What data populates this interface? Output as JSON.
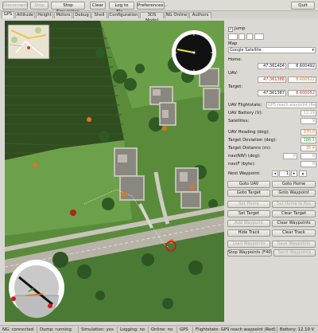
{
  "toolbar": {
    "disconnect": "Disconnect",
    "stop": "Stop",
    "stop_simulation": "Stop Simulation",
    "clear": "Clear",
    "log_to_file": "Log to file...",
    "preferences": "Preferences...",
    "quit": "Quit"
  },
  "tabs": [
    "GPS",
    "Attitude",
    "Height",
    "Motors",
    "Debug",
    "Shell",
    "Configuration",
    "3DS Model",
    "NG Online",
    "Authors"
  ],
  "active_tab": "GPS",
  "map_type_label": "Map",
  "panel": {
    "jump_label": "Jump",
    "jump_checked": true,
    "map_select": "Google Satellite",
    "home_label": "Home:",
    "home_lat": "47.361404",
    "home_lon": "8.600492",
    "uav_label": "UAV:",
    "uav_lat": "47.361388",
    "uav_lon": "8.600522",
    "target_label": "Target:",
    "target_lat": "47.361387",
    "target_lon": "8.600052",
    "flightstate_label": "UAV Flightstate:",
    "flightstate_value": "GPS reach waypoint (Red)",
    "battery_label": "UAV Battery (V):",
    "battery_value": "12.19",
    "satellites_label": "Satellites:",
    "satellites_value": "9",
    "heading_label": "UAV Heading (deg):",
    "heading_value": "270.0",
    "deviation_label": "Target Deviation (deg):",
    "deviation_value": "186.1",
    "distance_label": "Target Distance (m):",
    "distance_value": "35.4",
    "nav_label": "nav(NW) (deg):",
    "nav_value1": "0",
    "nav_value2": "0",
    "navf_label": "nav(F (byte):",
    "navf_value": "0",
    "next_wp_label": "Next Waypoint:",
    "next_wp_value": "1",
    "buttons": {
      "goto_uav": "Goto UAV",
      "goto_home": "Goto Home",
      "goto_target": "Goto Target",
      "goto_waypoint": "Goto Waypoint",
      "set_home": "Set Home",
      "set_home_to_pos": "Set Home to Pos",
      "set_target": "Set Target",
      "clear_target": "Clear Target",
      "add_waypoint": "Add Waypoint",
      "clear_waypoints": "Clear Waypoints",
      "hide_track": "Hide Track",
      "clear_track": "Clear Track",
      "load_waypoints": "Load Waypoints",
      "save_waypoints": "Save Waypoints",
      "stop_waypoints": "Stop Waypoints (F40)",
      "send_waypoints": "Send Waypoints"
    }
  },
  "status": {
    "ng": "NG: connected",
    "dump": "Dump: running",
    "simulation": "Simulation: yes",
    "logging": "Logging: no",
    "online": "Online: no",
    "gps": "GPS",
    "flightstate": "Flightstate: GPS reach waypoint (Red)",
    "battery": "Battery: 12.19 V"
  },
  "colors": {
    "grass": "#4f8a34",
    "field_dark": "#2d4a1c",
    "road": "#b7b3a8",
    "marker": "#e0761a",
    "uav_red": "#c41c1c"
  }
}
